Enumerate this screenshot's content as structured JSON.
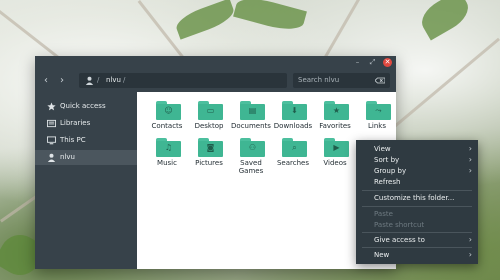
{
  "window": {
    "minimize_glyph": "–",
    "maximize_glyph": "⤢",
    "close_glyph": "✕"
  },
  "navbar": {
    "back_glyph": "‹",
    "forward_glyph": "›",
    "separator": "/",
    "breadcrumb": "nlvu",
    "trailing_separator": "/",
    "search_placeholder": "Search nlvu",
    "view_toggle_icon": "view-toggle-icon"
  },
  "sidebar": {
    "items": [
      {
        "label": "Quick access",
        "icon": "star-icon"
      },
      {
        "label": "Libraries",
        "icon": "library-icon"
      },
      {
        "label": "This PC",
        "icon": "computer-icon"
      },
      {
        "label": "nlvu",
        "icon": "user-icon",
        "active": true
      }
    ]
  },
  "folders": [
    {
      "label": "Contacts",
      "glyph": "☺"
    },
    {
      "label": "Desktop",
      "glyph": "▭"
    },
    {
      "label": "Documents",
      "glyph": "▤"
    },
    {
      "label": "Downloads",
      "glyph": "⬇"
    },
    {
      "label": "Favorites",
      "glyph": "★"
    },
    {
      "label": "Links",
      "glyph": "⤳"
    },
    {
      "label": "Music",
      "glyph": "♫"
    },
    {
      "label": "Pictures",
      "glyph": "◙"
    },
    {
      "label": "Saved Games",
      "glyph": "⚇"
    },
    {
      "label": "Searches",
      "glyph": "⌕"
    },
    {
      "label": "Videos",
      "glyph": "▶"
    }
  ],
  "context_menu": {
    "items": [
      {
        "label": "View",
        "submenu": true,
        "disabled": false
      },
      {
        "label": "Sort by",
        "submenu": true,
        "disabled": false
      },
      {
        "label": "Group by",
        "submenu": true,
        "disabled": false
      },
      {
        "label": "Refresh",
        "submenu": false,
        "disabled": false
      },
      {
        "label": "Customize this folder...",
        "submenu": false,
        "disabled": false
      },
      {
        "label": "Paste",
        "submenu": false,
        "disabled": true
      },
      {
        "label": "Paste shortcut",
        "submenu": false,
        "disabled": true
      },
      {
        "label": "Give access to",
        "submenu": true,
        "disabled": false
      },
      {
        "label": "New",
        "submenu": true,
        "disabled": false
      }
    ],
    "submenu_glyph": "›"
  },
  "colors": {
    "chrome": "#37424a",
    "folder_accent": "#3fb693",
    "close_button": "#e0483f",
    "menu_bg": "#2f3a41"
  }
}
